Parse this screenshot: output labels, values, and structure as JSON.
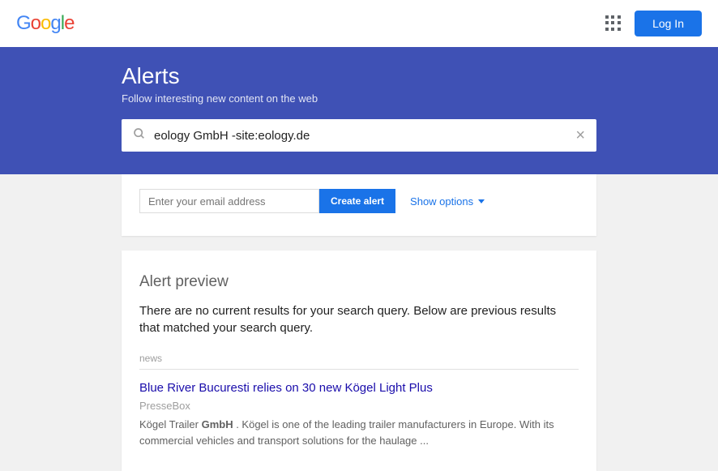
{
  "topbar": {
    "login_label": "Log In"
  },
  "hero": {
    "title": "Alerts",
    "subtitle": "Follow interesting new content on the web"
  },
  "search": {
    "value": "eology GmbH -site:eology.de"
  },
  "create": {
    "email_placeholder": "Enter your email address",
    "create_label": "Create alert",
    "options_label": "Show options"
  },
  "preview": {
    "title": "Alert preview",
    "message": "There are no current results for your search query. Below are previous results that matched your search query.",
    "category": "news",
    "results": [
      {
        "title": "Blue River Bucuresti relies on 30 new Kögel Light Plus",
        "source": "PresseBox",
        "snippet_prefix": "Kögel Trailer ",
        "snippet_bold": "GmbH",
        "snippet_suffix": " . Kögel is one of the leading trailer manufacturers in Europe. With its commercial vehicles and transport solutions for the haulage ..."
      }
    ]
  }
}
